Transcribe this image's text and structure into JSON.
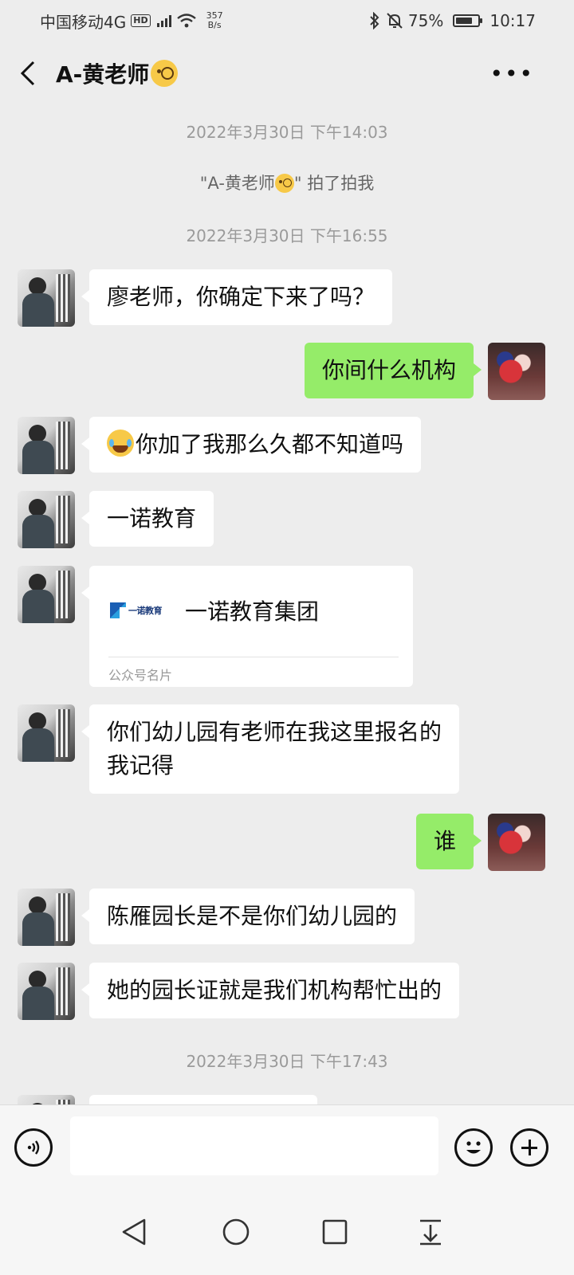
{
  "status_bar": {
    "carrier": "中国移动4G",
    "hd": "HD",
    "network_type": "4G",
    "net_speed_value": "357",
    "net_speed_unit": "B/s",
    "battery_percent": "75%",
    "battery_level": 0.75,
    "time": "10:17"
  },
  "header": {
    "title": "A-黄老师",
    "title_emoji": "face-with-monocle-icon",
    "more_label": "•••"
  },
  "messages": [
    {
      "kind": "time",
      "text": "2022年3月30日 下午14:03"
    },
    {
      "kind": "system",
      "text_before": "\"A-黄老师",
      "text_after": "\" 拍了拍我"
    },
    {
      "kind": "time",
      "text": "2022年3月30日 下午16:55"
    },
    {
      "kind": "text",
      "from": "them",
      "text": "廖老师，你确定下来了吗？"
    },
    {
      "kind": "text",
      "from": "me",
      "text": "你间什么机构"
    },
    {
      "kind": "text",
      "from": "them",
      "text": "你加了我那么久都不知道吗",
      "leading_emoji": "tears-of-joy-icon"
    },
    {
      "kind": "text",
      "from": "them",
      "text": "一诺教育"
    },
    {
      "kind": "card",
      "from": "them",
      "logo_text": "一诺教育",
      "name": "一诺教育集团",
      "card_type": "公众号名片"
    },
    {
      "kind": "text",
      "from": "them",
      "text": "你们幼儿园有老师在我这里报名的\n我记得"
    },
    {
      "kind": "text",
      "from": "me",
      "text": "谁"
    },
    {
      "kind": "text",
      "from": "them",
      "text": "陈雁园长是不是你们幼儿园的"
    },
    {
      "kind": "text",
      "from": "them",
      "text": "她的园长证就是我们机构帮忙出的"
    },
    {
      "kind": "time",
      "text": "2022年3月30日 下午17:43"
    }
  ],
  "input_bar": {
    "voice_icon": "voice-icon",
    "input_value": "",
    "emoji_icon": "emoji-icon",
    "plus_icon": "plus-icon"
  },
  "nav_bar": {
    "back": "nav-back-icon",
    "home": "nav-home-icon",
    "recents": "nav-recents-icon",
    "notifications": "nav-pulldown-icon"
  },
  "colors": {
    "background": "#ededed",
    "my_bubble": "#95ec69",
    "their_bubble": "#ffffff",
    "timestamp": "#9a9a9a"
  }
}
